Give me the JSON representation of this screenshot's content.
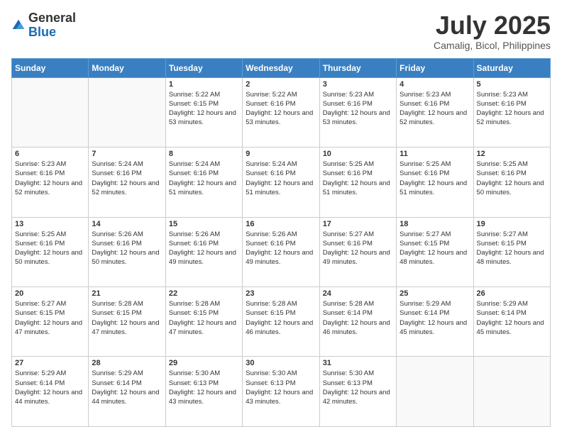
{
  "header": {
    "logo_line1": "General",
    "logo_line2": "Blue",
    "title": "July 2025",
    "subtitle": "Camalig, Bicol, Philippines"
  },
  "days_of_week": [
    "Sunday",
    "Monday",
    "Tuesday",
    "Wednesday",
    "Thursday",
    "Friday",
    "Saturday"
  ],
  "weeks": [
    [
      {
        "day": "",
        "sunrise": "",
        "sunset": "",
        "daylight": ""
      },
      {
        "day": "",
        "sunrise": "",
        "sunset": "",
        "daylight": ""
      },
      {
        "day": "1",
        "sunrise": "Sunrise: 5:22 AM",
        "sunset": "Sunset: 6:15 PM",
        "daylight": "Daylight: 12 hours and 53 minutes."
      },
      {
        "day": "2",
        "sunrise": "Sunrise: 5:22 AM",
        "sunset": "Sunset: 6:16 PM",
        "daylight": "Daylight: 12 hours and 53 minutes."
      },
      {
        "day": "3",
        "sunrise": "Sunrise: 5:23 AM",
        "sunset": "Sunset: 6:16 PM",
        "daylight": "Daylight: 12 hours and 53 minutes."
      },
      {
        "day": "4",
        "sunrise": "Sunrise: 5:23 AM",
        "sunset": "Sunset: 6:16 PM",
        "daylight": "Daylight: 12 hours and 52 minutes."
      },
      {
        "day": "5",
        "sunrise": "Sunrise: 5:23 AM",
        "sunset": "Sunset: 6:16 PM",
        "daylight": "Daylight: 12 hours and 52 minutes."
      }
    ],
    [
      {
        "day": "6",
        "sunrise": "Sunrise: 5:23 AM",
        "sunset": "Sunset: 6:16 PM",
        "daylight": "Daylight: 12 hours and 52 minutes."
      },
      {
        "day": "7",
        "sunrise": "Sunrise: 5:24 AM",
        "sunset": "Sunset: 6:16 PM",
        "daylight": "Daylight: 12 hours and 52 minutes."
      },
      {
        "day": "8",
        "sunrise": "Sunrise: 5:24 AM",
        "sunset": "Sunset: 6:16 PM",
        "daylight": "Daylight: 12 hours and 51 minutes."
      },
      {
        "day": "9",
        "sunrise": "Sunrise: 5:24 AM",
        "sunset": "Sunset: 6:16 PM",
        "daylight": "Daylight: 12 hours and 51 minutes."
      },
      {
        "day": "10",
        "sunrise": "Sunrise: 5:25 AM",
        "sunset": "Sunset: 6:16 PM",
        "daylight": "Daylight: 12 hours and 51 minutes."
      },
      {
        "day": "11",
        "sunrise": "Sunrise: 5:25 AM",
        "sunset": "Sunset: 6:16 PM",
        "daylight": "Daylight: 12 hours and 51 minutes."
      },
      {
        "day": "12",
        "sunrise": "Sunrise: 5:25 AM",
        "sunset": "Sunset: 6:16 PM",
        "daylight": "Daylight: 12 hours and 50 minutes."
      }
    ],
    [
      {
        "day": "13",
        "sunrise": "Sunrise: 5:25 AM",
        "sunset": "Sunset: 6:16 PM",
        "daylight": "Daylight: 12 hours and 50 minutes."
      },
      {
        "day": "14",
        "sunrise": "Sunrise: 5:26 AM",
        "sunset": "Sunset: 6:16 PM",
        "daylight": "Daylight: 12 hours and 50 minutes."
      },
      {
        "day": "15",
        "sunrise": "Sunrise: 5:26 AM",
        "sunset": "Sunset: 6:16 PM",
        "daylight": "Daylight: 12 hours and 49 minutes."
      },
      {
        "day": "16",
        "sunrise": "Sunrise: 5:26 AM",
        "sunset": "Sunset: 6:16 PM",
        "daylight": "Daylight: 12 hours and 49 minutes."
      },
      {
        "day": "17",
        "sunrise": "Sunrise: 5:27 AM",
        "sunset": "Sunset: 6:16 PM",
        "daylight": "Daylight: 12 hours and 49 minutes."
      },
      {
        "day": "18",
        "sunrise": "Sunrise: 5:27 AM",
        "sunset": "Sunset: 6:15 PM",
        "daylight": "Daylight: 12 hours and 48 minutes."
      },
      {
        "day": "19",
        "sunrise": "Sunrise: 5:27 AM",
        "sunset": "Sunset: 6:15 PM",
        "daylight": "Daylight: 12 hours and 48 minutes."
      }
    ],
    [
      {
        "day": "20",
        "sunrise": "Sunrise: 5:27 AM",
        "sunset": "Sunset: 6:15 PM",
        "daylight": "Daylight: 12 hours and 47 minutes."
      },
      {
        "day": "21",
        "sunrise": "Sunrise: 5:28 AM",
        "sunset": "Sunset: 6:15 PM",
        "daylight": "Daylight: 12 hours and 47 minutes."
      },
      {
        "day": "22",
        "sunrise": "Sunrise: 5:28 AM",
        "sunset": "Sunset: 6:15 PM",
        "daylight": "Daylight: 12 hours and 47 minutes."
      },
      {
        "day": "23",
        "sunrise": "Sunrise: 5:28 AM",
        "sunset": "Sunset: 6:15 PM",
        "daylight": "Daylight: 12 hours and 46 minutes."
      },
      {
        "day": "24",
        "sunrise": "Sunrise: 5:28 AM",
        "sunset": "Sunset: 6:14 PM",
        "daylight": "Daylight: 12 hours and 46 minutes."
      },
      {
        "day": "25",
        "sunrise": "Sunrise: 5:29 AM",
        "sunset": "Sunset: 6:14 PM",
        "daylight": "Daylight: 12 hours and 45 minutes."
      },
      {
        "day": "26",
        "sunrise": "Sunrise: 5:29 AM",
        "sunset": "Sunset: 6:14 PM",
        "daylight": "Daylight: 12 hours and 45 minutes."
      }
    ],
    [
      {
        "day": "27",
        "sunrise": "Sunrise: 5:29 AM",
        "sunset": "Sunset: 6:14 PM",
        "daylight": "Daylight: 12 hours and 44 minutes."
      },
      {
        "day": "28",
        "sunrise": "Sunrise: 5:29 AM",
        "sunset": "Sunset: 6:14 PM",
        "daylight": "Daylight: 12 hours and 44 minutes."
      },
      {
        "day": "29",
        "sunrise": "Sunrise: 5:30 AM",
        "sunset": "Sunset: 6:13 PM",
        "daylight": "Daylight: 12 hours and 43 minutes."
      },
      {
        "day": "30",
        "sunrise": "Sunrise: 5:30 AM",
        "sunset": "Sunset: 6:13 PM",
        "daylight": "Daylight: 12 hours and 43 minutes."
      },
      {
        "day": "31",
        "sunrise": "Sunrise: 5:30 AM",
        "sunset": "Sunset: 6:13 PM",
        "daylight": "Daylight: 12 hours and 42 minutes."
      },
      {
        "day": "",
        "sunrise": "",
        "sunset": "",
        "daylight": ""
      },
      {
        "day": "",
        "sunrise": "",
        "sunset": "",
        "daylight": ""
      }
    ]
  ]
}
